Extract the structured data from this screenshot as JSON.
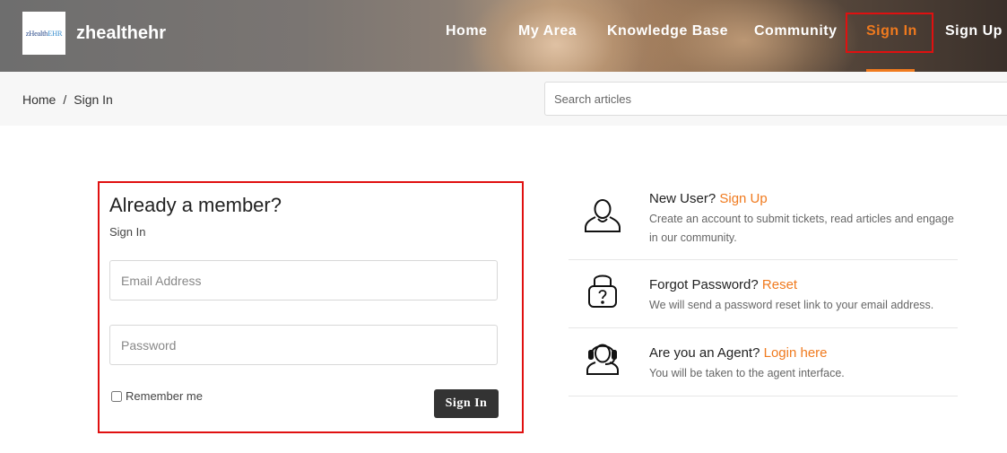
{
  "header": {
    "logo_prefix": "zHealth",
    "logo_suffix": "EHR",
    "brand_name": "zhealthehr",
    "nav": [
      {
        "label": "Home"
      },
      {
        "label": "My Area"
      },
      {
        "label": "Knowledge Base"
      },
      {
        "label": "Community"
      },
      {
        "label": "Sign In",
        "active": true
      },
      {
        "label": "Sign Up"
      }
    ],
    "accent_color": "#f07a1e",
    "highlight_color": "#e01010"
  },
  "breadcrumb": {
    "home": "Home",
    "separator": "/",
    "current": "Sign In"
  },
  "search": {
    "placeholder": "Search articles"
  },
  "signin_card": {
    "title": "Already a member?",
    "subtitle": "Sign In",
    "email_placeholder": "Email Address",
    "password_placeholder": "Password",
    "remember_label": "Remember me",
    "remember_checked": false,
    "submit_label": "Sign In"
  },
  "info": [
    {
      "icon": "user-icon",
      "title": "New User?",
      "link": "Sign Up",
      "description": "Create an account to submit tickets, read articles and engage in our community."
    },
    {
      "icon": "lock-question-icon",
      "title": "Forgot Password?",
      "link": "Reset",
      "description": "We will send a password reset link to your email address."
    },
    {
      "icon": "agent-headset-icon",
      "title": "Are you an Agent?",
      "link": "Login here",
      "description": "You will be taken to the agent interface."
    }
  ]
}
